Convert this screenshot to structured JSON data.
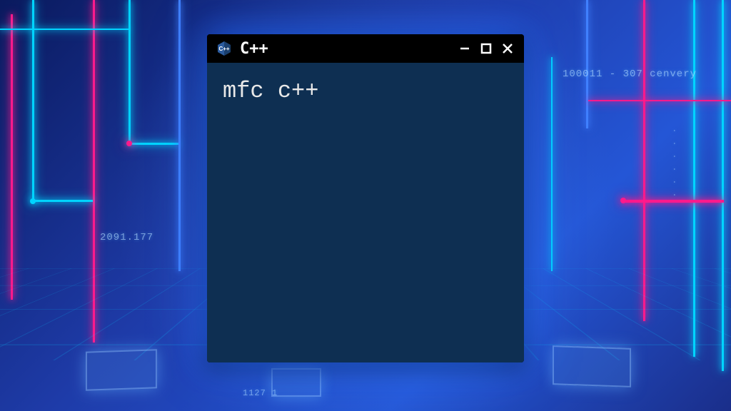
{
  "window": {
    "title": "C++",
    "icon_name": "cpp-hexagon-icon"
  },
  "terminal": {
    "content": "mfc c++"
  },
  "background": {
    "labels": {
      "topright": "100011 - 307  cenvery",
      "midleft": "2091.177",
      "bottom": "1127 1",
      "rightvert": "· · · · · ·"
    }
  },
  "colors": {
    "neon_pink": "#ff1a8c",
    "neon_cyan": "#00d4ff",
    "neon_blue": "#4080ff",
    "terminal_bg": "#0e2f52"
  }
}
